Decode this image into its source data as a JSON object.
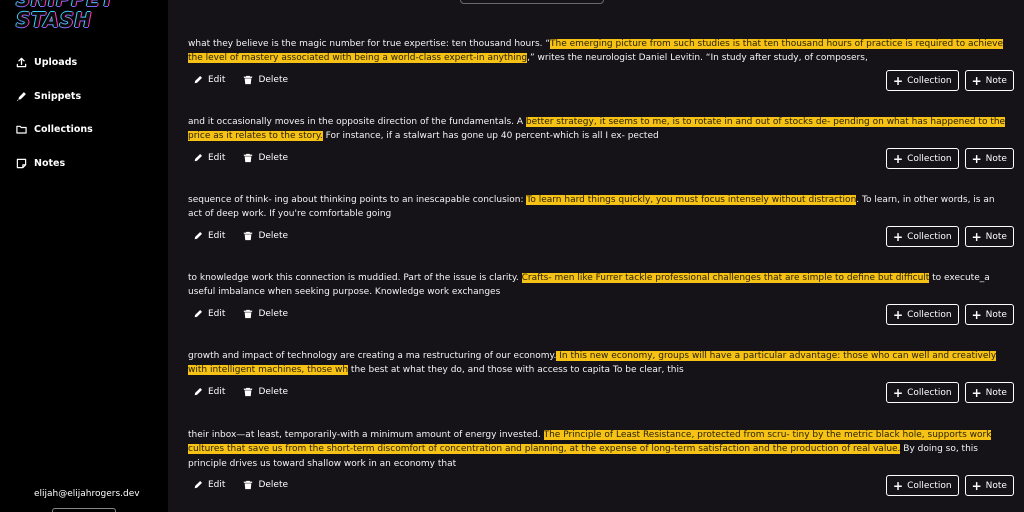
{
  "app": {
    "logo_line1": "SNIPPET",
    "logo_line2": "STASH"
  },
  "sidebar": {
    "items": [
      {
        "label": "Uploads",
        "icon": "upload-icon"
      },
      {
        "label": "Snippets",
        "icon": "pen-icon"
      },
      {
        "label": "Collections",
        "icon": "folder-icon"
      },
      {
        "label": "Notes",
        "icon": "note-icon"
      }
    ],
    "user_email": "elijah@elijahrogers.dev"
  },
  "actions": {
    "edit_label": "Edit",
    "delete_label": "Delete",
    "collection_label": "Collection",
    "note_label": "Note"
  },
  "snippets": [
    {
      "before": "what they believe is the magic number for true expertise: ten thousand hours. “",
      "highlight": "The emerging picture from such studies is that ten thousand hours of practice is required to achieve the level of mastery associated with being a world-class expert-in anything",
      "after": ",” writes the neurologist Daniel Levitin. “In study after study, of composers,"
    },
    {
      "before": "and it occasionally moves in the opposite direction of the fundamentals. A ",
      "highlight": "better strategy, it seems to me, is to rotate in and out of stocks de- pending on what has happened to the price as it relates to the story.",
      "after": " For instance, if a stalwart has gone up 40 percent-which is all I ex- pected"
    },
    {
      "before": "sequence of think- ing about thinking points to an inescapable conclusion: ",
      "highlight": "To learn hard things quickly, you must focus intensely without distraction",
      "after": ". To learn, in other words, is an act of deep work. If you're comfortable going"
    },
    {
      "before": "to knowledge work this connection is muddied. Part of the issue is clarity. ",
      "highlight": "Crafts- men like Furrer tackle professional challenges that are simple to define but difficult",
      "after": " to execute_a useful imbalance when seeking purpose. Knowledge work exchanges"
    },
    {
      "before": "growth and impact of technology are creating a ma restructuring of our economy.",
      "highlight": " In this new economy, groups will have a particular advantage: those who can well and creatively with intelligent machines, those wh",
      "after": " the best at what they do, and those with access to capita To be clear, this"
    },
    {
      "before": "their inbox—at least, temporarily-with a minimum amount of energy invested. ",
      "highlight": "The Principle of Least Resistance, protected from scru- tiny by the metric black hole, supports work cultures that save us from the short-term discomfort of concentration and planning, at the expense of long-term satisfaction and the production of real value.",
      "after": " By doing so, this principle drives us toward shallow work in an economy that"
    }
  ]
}
